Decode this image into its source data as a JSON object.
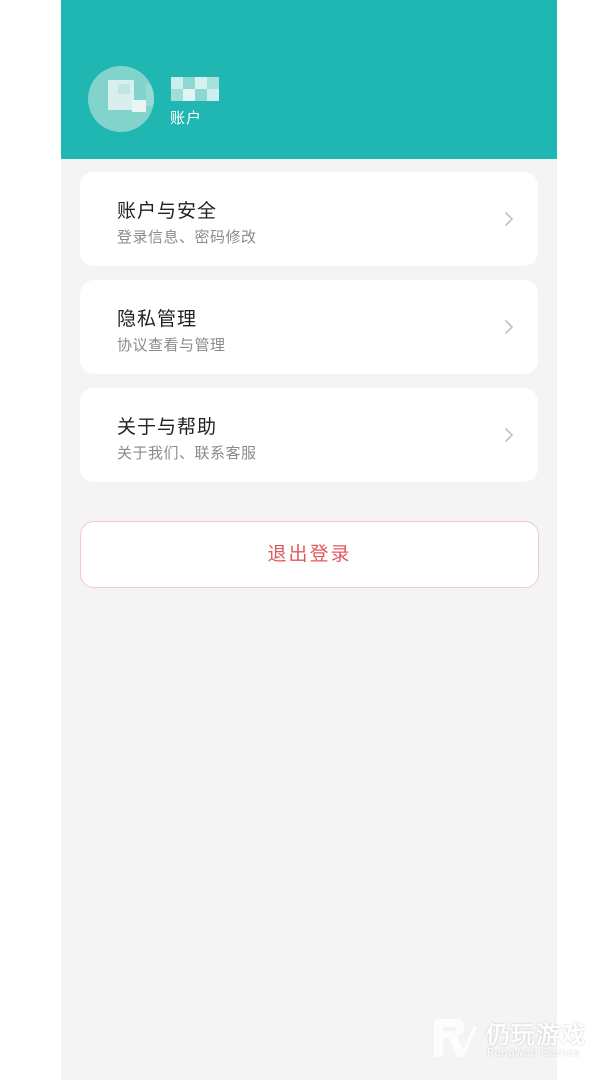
{
  "header": {
    "account_label": "账户",
    "accent_color": "#20b6b1"
  },
  "menu": [
    {
      "title": "账户与安全",
      "subtitle": "登录信息、密码修改",
      "icon": "chevron-right-icon"
    },
    {
      "title": "隐私管理",
      "subtitle": "协议查看与管理",
      "icon": "chevron-right-icon"
    },
    {
      "title": "关于与帮助",
      "subtitle": "关于我们、联系客服",
      "icon": "chevron-right-icon"
    }
  ],
  "logout": {
    "label": "退出登录",
    "color": "#e0585f"
  },
  "watermark": {
    "brand_cn": "仍玩游戏",
    "brand_en": "Rengwan Games"
  }
}
